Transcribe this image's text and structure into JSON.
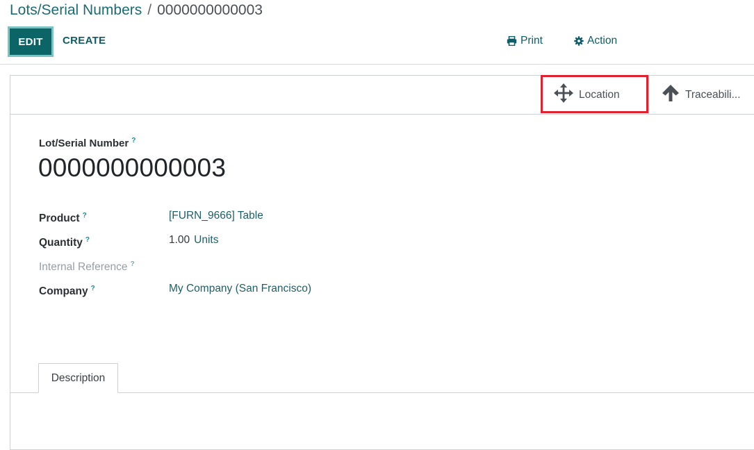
{
  "breadcrumb": {
    "parent": "Lots/Serial Numbers",
    "separator": "/",
    "current": "0000000000003"
  },
  "control_panel": {
    "edit_label": "EDIT",
    "create_label": "CREATE",
    "print_label": "Print",
    "action_label": "Action"
  },
  "smart_buttons": {
    "location": {
      "label": "Location",
      "icon": "arrows-move-icon"
    },
    "traceability": {
      "label": "Traceabili...",
      "icon": "arrow-up-icon"
    }
  },
  "record": {
    "title_label": "Lot/Serial Number",
    "help_mark": "?",
    "name": "0000000000003"
  },
  "fields": {
    "product": {
      "label": "Product",
      "value": "[FURN_9666] Table"
    },
    "quantity": {
      "label": "Quantity",
      "value": "1.00",
      "unit": "Units"
    },
    "internal_reference": {
      "label": "Internal Reference",
      "value": ""
    },
    "company": {
      "label": "Company",
      "value": "My Company (San Francisco)"
    }
  },
  "tabs": {
    "description": "Description"
  },
  "colors": {
    "primary": "#00676d",
    "link": "#1d6b73",
    "highlight": "#e0212f"
  }
}
